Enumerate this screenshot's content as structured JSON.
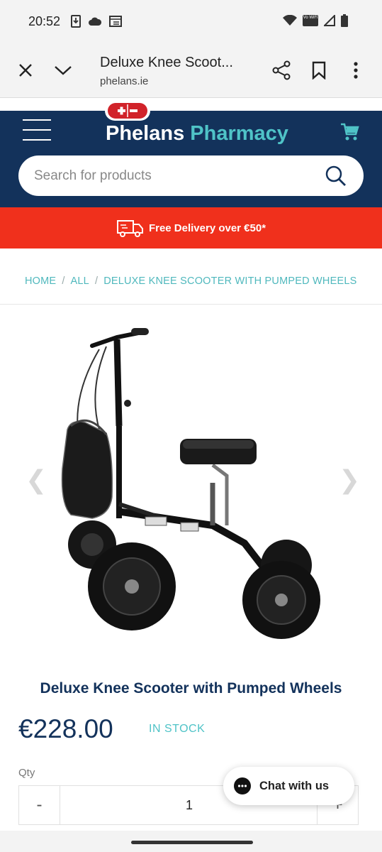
{
  "status_bar": {
    "time": "20:52",
    "icons_left": [
      "download-icon",
      "cloud-icon",
      "window-icon"
    ],
    "icons_right": [
      "wifi-icon",
      "wifi-calling-icon",
      "signal-icon",
      "battery-icon"
    ],
    "wifi_calling_label": "Vo WiFi"
  },
  "browser": {
    "page_title": "Deluxe Knee Scoot...",
    "url": "phelans.ie"
  },
  "site": {
    "brand_word1": "Phelans",
    "brand_word2": "Pharmacy",
    "search_placeholder": "Search for products",
    "delivery_text": "Free Delivery over €50*",
    "brand_color": "#13325b",
    "accent_color": "#4fc3c7",
    "banner_color": "#f0301c"
  },
  "breadcrumb": [
    "HOME",
    "ALL",
    "DELUXE KNEE SCOOTER WITH PUMPED WHEELS"
  ],
  "product": {
    "title": "Deluxe Knee Scooter with Pumped Wheels",
    "price": "€228.00",
    "stock": "IN STOCK",
    "qty_label": "Qty",
    "qty_value": "1",
    "qty_minus": "-",
    "qty_plus": "+"
  },
  "chat": {
    "label": "Chat with us"
  }
}
